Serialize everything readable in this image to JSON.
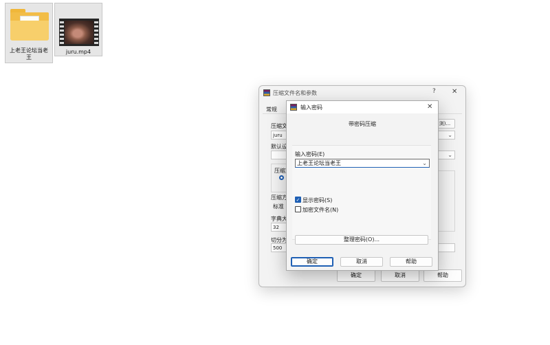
{
  "desktop": {
    "folder_label": "上老王论坛当老王",
    "video_label": "juru.mp4"
  },
  "back_dialog": {
    "title": "压缩文件名和参数",
    "help_glyph": "?",
    "close_glyph": "✕",
    "tab_general": "常规",
    "archive_name_label": "压缩文",
    "archive_name_value": "juru",
    "browse_label": "浏)...",
    "default_profile_label": "默认设",
    "format_label": "压缩文",
    "method_label": "压缩方",
    "method_value": "标准",
    "dict_label": "字典大",
    "dict_value": "32",
    "split_label": "切分为",
    "split_value": "500",
    "ok_label": "确定",
    "cancel_label": "取消",
    "help_label": "帮助"
  },
  "password_dialog": {
    "title": "输入密码",
    "close_glyph": "✕",
    "subtitle": "带密码压缩",
    "enter_label": "输入密码(E)",
    "password_value": "上老王论坛当老王",
    "show_password_label": "显示密码(S)",
    "encrypt_names_label": "加密文件名(N)",
    "organize_label": "整理密码(O)...",
    "ok_label": "确定",
    "cancel_label": "取消",
    "help_label": "帮助",
    "show_password_checked": true,
    "encrypt_names_checked": false
  },
  "colors": {
    "accent": "#1e5fb4"
  }
}
